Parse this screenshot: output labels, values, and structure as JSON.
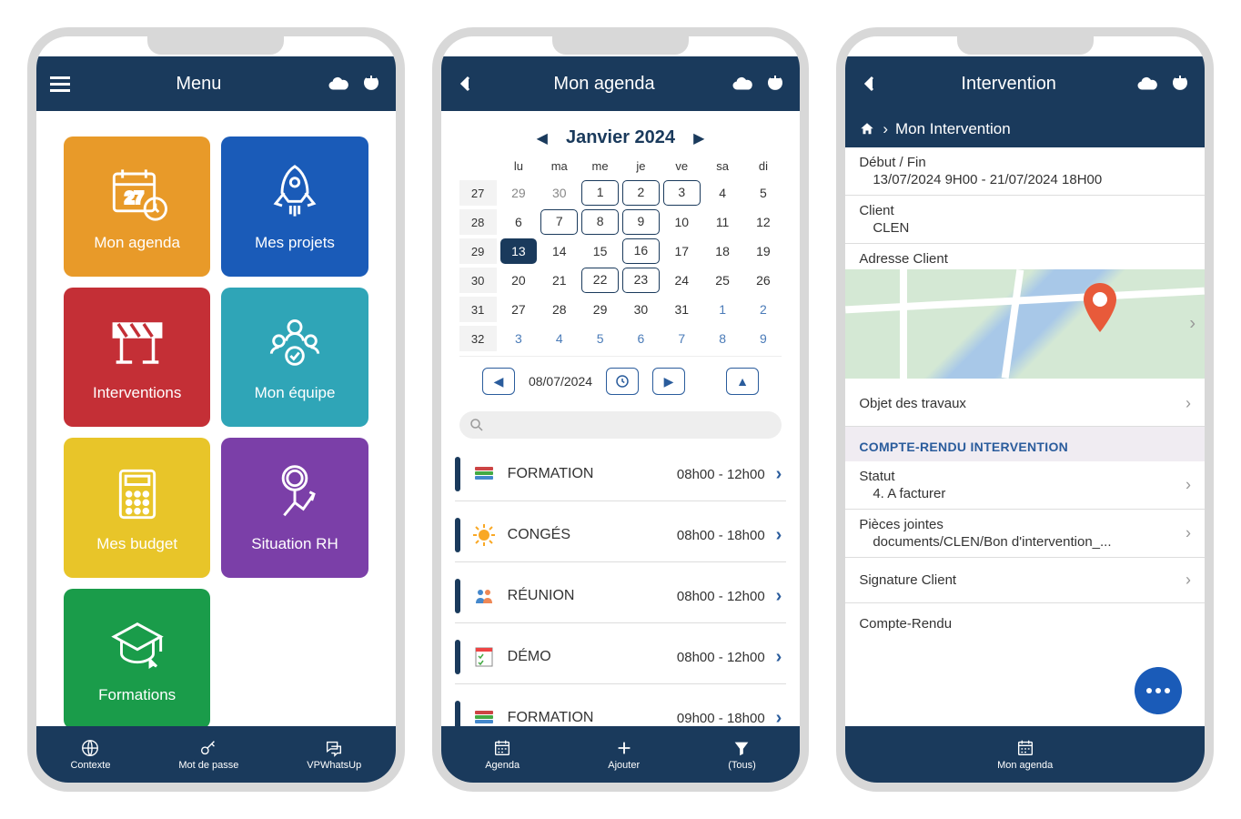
{
  "colors": {
    "navy": "#1a3a5c",
    "orange": "#e89a29",
    "blue": "#1a5bb8",
    "red": "#c42f36",
    "teal": "#2fa5b7",
    "yellow": "#e8c529",
    "purple": "#7b3fa8",
    "green": "#1a9c4a"
  },
  "phone1": {
    "header_title": "Menu",
    "tiles": [
      {
        "label": "Mon agenda",
        "icon": "calendar",
        "color": "orange"
      },
      {
        "label": "Mes projets",
        "icon": "rocket",
        "color": "blue"
      },
      {
        "label": "Interventions",
        "icon": "barrier",
        "color": "red"
      },
      {
        "label": "Mon équipe",
        "icon": "team",
        "color": "teal"
      },
      {
        "label": "Mes budget",
        "icon": "calculator",
        "color": "yellow"
      },
      {
        "label": "Situation RH",
        "icon": "person-chart",
        "color": "purple"
      },
      {
        "label": "Formations",
        "icon": "graduation",
        "color": "green"
      }
    ],
    "bottom": [
      {
        "label": "Contexte",
        "icon": "globe"
      },
      {
        "label": "Mot de passe",
        "icon": "key"
      },
      {
        "label": "VPWhatsUp",
        "icon": "chat"
      }
    ]
  },
  "phone2": {
    "header_title": "Mon agenda",
    "calendar": {
      "month_label": "Janvier 2024",
      "dow": [
        "lu",
        "ma",
        "me",
        "je",
        "ve",
        "sa",
        "di"
      ],
      "weeks": [
        {
          "num": "27",
          "days": [
            {
              "d": "29",
              "o": true
            },
            {
              "d": "30",
              "o": true
            },
            {
              "d": "1",
              "ring": true
            },
            {
              "d": "2",
              "ring": true
            },
            {
              "d": "3",
              "ring": true
            },
            {
              "d": "4"
            },
            {
              "d": "5"
            }
          ]
        },
        {
          "num": "28",
          "days": [
            {
              "d": "6"
            },
            {
              "d": "7",
              "ring": true
            },
            {
              "d": "8",
              "ring": true
            },
            {
              "d": "9",
              "ring": true
            },
            {
              "d": "10"
            },
            {
              "d": "11"
            },
            {
              "d": "12"
            }
          ]
        },
        {
          "num": "29",
          "days": [
            {
              "d": "13",
              "sel": true
            },
            {
              "d": "14"
            },
            {
              "d": "15"
            },
            {
              "d": "16",
              "ring": true
            },
            {
              "d": "17"
            },
            {
              "d": "18"
            },
            {
              "d": "19"
            }
          ]
        },
        {
          "num": "30",
          "days": [
            {
              "d": "20"
            },
            {
              "d": "21"
            },
            {
              "d": "22",
              "ring": true
            },
            {
              "d": "23",
              "ring": true
            },
            {
              "d": "24"
            },
            {
              "d": "25"
            },
            {
              "d": "26"
            }
          ]
        },
        {
          "num": "31",
          "days": [
            {
              "d": "27"
            },
            {
              "d": "28"
            },
            {
              "d": "29"
            },
            {
              "d": "30"
            },
            {
              "d": "31"
            },
            {
              "d": "1",
              "n": true
            },
            {
              "d": "2",
              "n": true
            }
          ]
        },
        {
          "num": "32",
          "days": [
            {
              "d": "3",
              "n": true
            },
            {
              "d": "4",
              "n": true
            },
            {
              "d": "5",
              "n": true
            },
            {
              "d": "6",
              "n": true
            },
            {
              "d": "7",
              "n": true
            },
            {
              "d": "8",
              "n": true
            },
            {
              "d": "9",
              "n": true
            }
          ]
        }
      ],
      "current_date": "08/07/2024"
    },
    "events": [
      {
        "name": "FORMATION",
        "time": "08h00 - 12h00",
        "icon": "books"
      },
      {
        "name": "CONGÉS",
        "time": "08h00 - 18h00",
        "icon": "sun"
      },
      {
        "name": "RÉUNION",
        "time": "08h00 - 12h00",
        "icon": "people"
      },
      {
        "name": "DÉMO",
        "time": "08h00 - 12h00",
        "icon": "checklist"
      },
      {
        "name": "FORMATION",
        "time": "09h00 - 18h00",
        "icon": "books"
      }
    ],
    "bottom": [
      {
        "label": "Agenda",
        "icon": "calendar"
      },
      {
        "label": "Ajouter",
        "icon": "plus"
      },
      {
        "label": "(Tous)",
        "icon": "filter"
      }
    ]
  },
  "phone3": {
    "header_title": "Intervention",
    "breadcrumb": "Mon Intervention",
    "fields": {
      "debut_label": "Début / Fin",
      "debut_value": "13/07/2024 9H00 - 21/07/2024 18H00",
      "client_label": "Client",
      "client_value": "CLEN",
      "adresse_label": "Adresse Client",
      "objet_label": "Objet des travaux",
      "section_title": "COMPTE-RENDU INTERVENTION",
      "statut_label": "Statut",
      "statut_value": "4. A facturer",
      "pieces_label": "Pièces jointes",
      "pieces_value": "documents/CLEN/Bon d'intervention_...",
      "signature_label": "Signature Client",
      "compte_rendu_label": "Compte-Rendu"
    },
    "bottom": [
      {
        "label": "Mon agenda",
        "icon": "calendar"
      }
    ]
  }
}
